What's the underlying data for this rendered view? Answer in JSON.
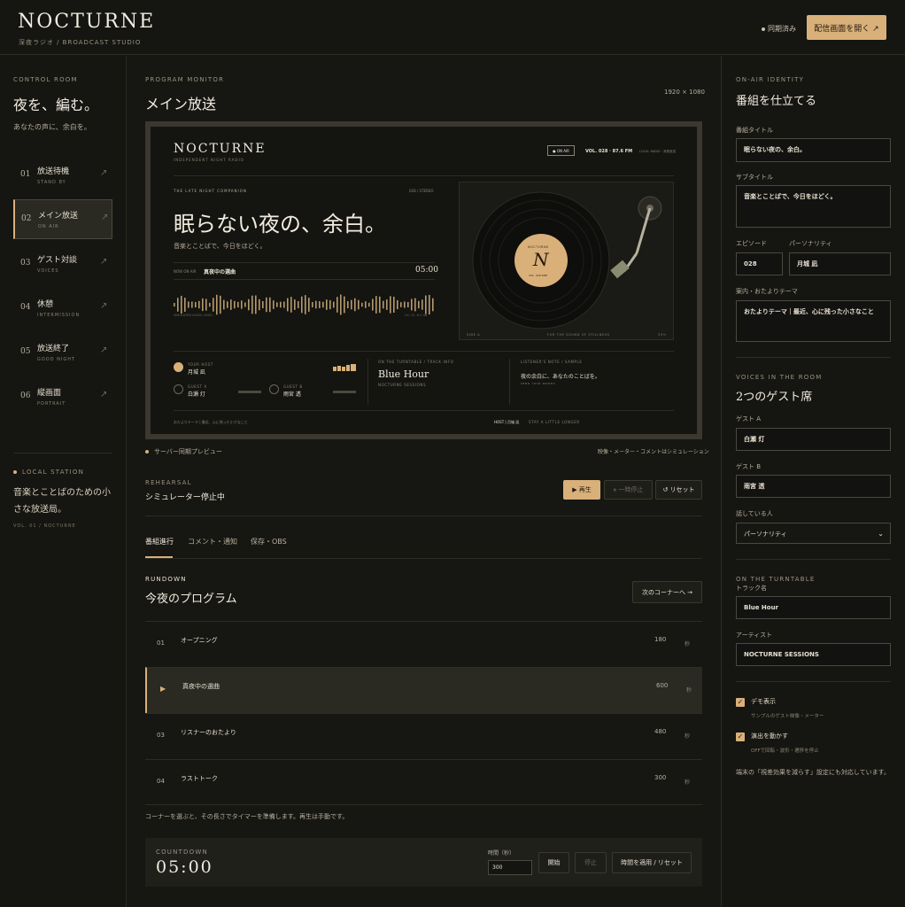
{
  "header": {
    "logo": "NOCTURNE",
    "subtitle": "深夜ラジオ / BROADCAST STUDIO",
    "sync_status": "同期済み",
    "open_button": "配信画面を開く ↗"
  },
  "left": {
    "section_label": "CONTROL ROOM",
    "title": "夜を、編む。",
    "subtitle": "あなたの声に、余白を。",
    "nav": [
      {
        "num": "01",
        "title": "放送待機",
        "sub": "STAND BY"
      },
      {
        "num": "02",
        "title": "メイン放送",
        "sub": "ON AIR"
      },
      {
        "num": "03",
        "title": "ゲスト対談",
        "sub": "VOICES"
      },
      {
        "num": "04",
        "title": "休憩",
        "sub": "INTERMISSION"
      },
      {
        "num": "05",
        "title": "放送終了",
        "sub": "GOOD NIGHT"
      },
      {
        "num": "06",
        "title": "縦画面",
        "sub": "PORTRAIT"
      }
    ],
    "arrow": "↗",
    "station_label": "LOCAL STATION",
    "station_text": "音楽とことばのための小さな放送局。",
    "vol": "VOL. 01 / NOCTURNE"
  },
  "center": {
    "section_label": "PROGRAM MONITOR",
    "title": "メイン放送",
    "resolution": "1920 × 1080",
    "screen": {
      "logo": "NOCTURNE",
      "logo_sub": "INDEPENDENT NIGHT RADIO",
      "on_air": "● ON AIR",
      "vol": "VOL. 028 · 87.6 FM",
      "location": "LOCAL RADIO · 深夜放送",
      "companion": "THE LATE NIGHT COMPANION",
      "stereo": "028 / STEREO",
      "headline": "眠らない夜の、余白。",
      "sub": "音楽とことばで、今日をほどく。",
      "now_label": "NOW ON AIR",
      "now_title": "真夜中の選曲",
      "time": "05:00",
      "wave_label": "SIMULATED AUDIO LEVEL",
      "db": "-24  -12  -6  0 dB",
      "record_brand": "NOCTURNE",
      "record_letter": "N",
      "record_sub": "VOL. 028 RPM",
      "tt_left": "SIDE A",
      "tt_center": "FOR THE SOUND OF STILLNESS",
      "tt_right": "33⅓",
      "host_label": "YOUR HOST",
      "host_name": "月城 凪",
      "guest_a_label": "GUEST A",
      "guest_a_name": "白瀬 灯",
      "guest_b_label": "GUEST B",
      "guest_b_name": "雨宮 透",
      "track_label": "ON THE TURNTABLE / TRACK INFO",
      "track_title": "Blue Hour",
      "track_artist": "NOCTURNE SESSIONS",
      "listener_label": "LISTENER'S NOTE / SAMPLE",
      "listener_text": "夜の余白に、あなたのことばを。",
      "listener_sub": "SEND YOUR WORDS",
      "foot_left": "おたよりテーマ | 最近、心に残った小さなこと",
      "foot_host": "HOST | 月城 凪",
      "foot_right": "STAY A LITTLE LONGER"
    },
    "preview_label": "サーバー同期プレビュー",
    "sim_note": "映像・メーター・コメントはシミュレーション",
    "rehearsal_label": "REHEARSAL",
    "rehearsal_title": "シミュレーター停止中",
    "btn_play": "▶ 再生",
    "btn_pause": "⏸ 一時停止",
    "btn_reset": "↺ リセット",
    "tabs": [
      "番組進行",
      "コメント・通知",
      "保存・OBS"
    ],
    "rundown_label": "RUNDOWN",
    "rundown_title": "今夜のプログラム",
    "next_button": "次のコーナーへ →",
    "rows": [
      {
        "num": "01",
        "title": "オープニング",
        "duration": "180",
        "unit": "秒"
      },
      {
        "num": "▶",
        "title": "真夜中の選曲",
        "duration": "600",
        "unit": "秒"
      },
      {
        "num": "03",
        "title": "リスナーのおたより",
        "duration": "480",
        "unit": "秒"
      },
      {
        "num": "04",
        "title": "ラストトーク",
        "duration": "300",
        "unit": "秒"
      }
    ],
    "rundown_note": "コーナーを選ぶと、その長さでタイマーを準備します。再生は手動です。",
    "countdown_label": "COUNTDOWN",
    "countdown_time": "05:00",
    "seconds_label": "時間（秒）",
    "seconds_value": "300",
    "btn_start": "開始",
    "btn_stop": "停止",
    "btn_apply": "時間を適用 / リセット"
  },
  "right": {
    "identity_label": "ON-AIR IDENTITY",
    "identity_title": "番組を仕立てる",
    "program_title_label": "番組タイトル",
    "program_title": "眠らない夜の、余白。",
    "subtitle_label": "サブタイトル",
    "subtitle": "音楽とことばで、今日をほどく。",
    "episode_label": "エピソード",
    "episode": "028",
    "personality_label": "パーソナリティ",
    "personality": "月城 凪",
    "theme_label": "案内・おたよりテーマ",
    "theme": "おたよりテーマ｜最近、心に残った小さなこと",
    "voices_label": "VOICES IN THE ROOM",
    "voices_title": "2つのゲスト席",
    "guest_a_label": "ゲスト A",
    "guest_a": "白瀬 灯",
    "guest_b_label": "ゲスト B",
    "guest_b": "雨宮 透",
    "speaker_label": "話している人",
    "speaker": "パーソナリティ",
    "turntable_label": "ON THE TURNTABLE",
    "track_label": "トラック名",
    "track": "Blue Hour",
    "artist_label": "アーティスト",
    "artist": "NOCTURNE SESSIONS",
    "demo_label": "デモ表示",
    "demo_sub": "サンプルのゲスト映像・メーター",
    "motion_label": "演出を動かす",
    "motion_sub": "OFFで回転・波形・遷移を停止",
    "note": "端末の「視差効果を減らす」設定にも対応しています。"
  },
  "colors": {
    "accent": "#d9b07a",
    "background": "#161612",
    "panel": "#2a2a23"
  }
}
